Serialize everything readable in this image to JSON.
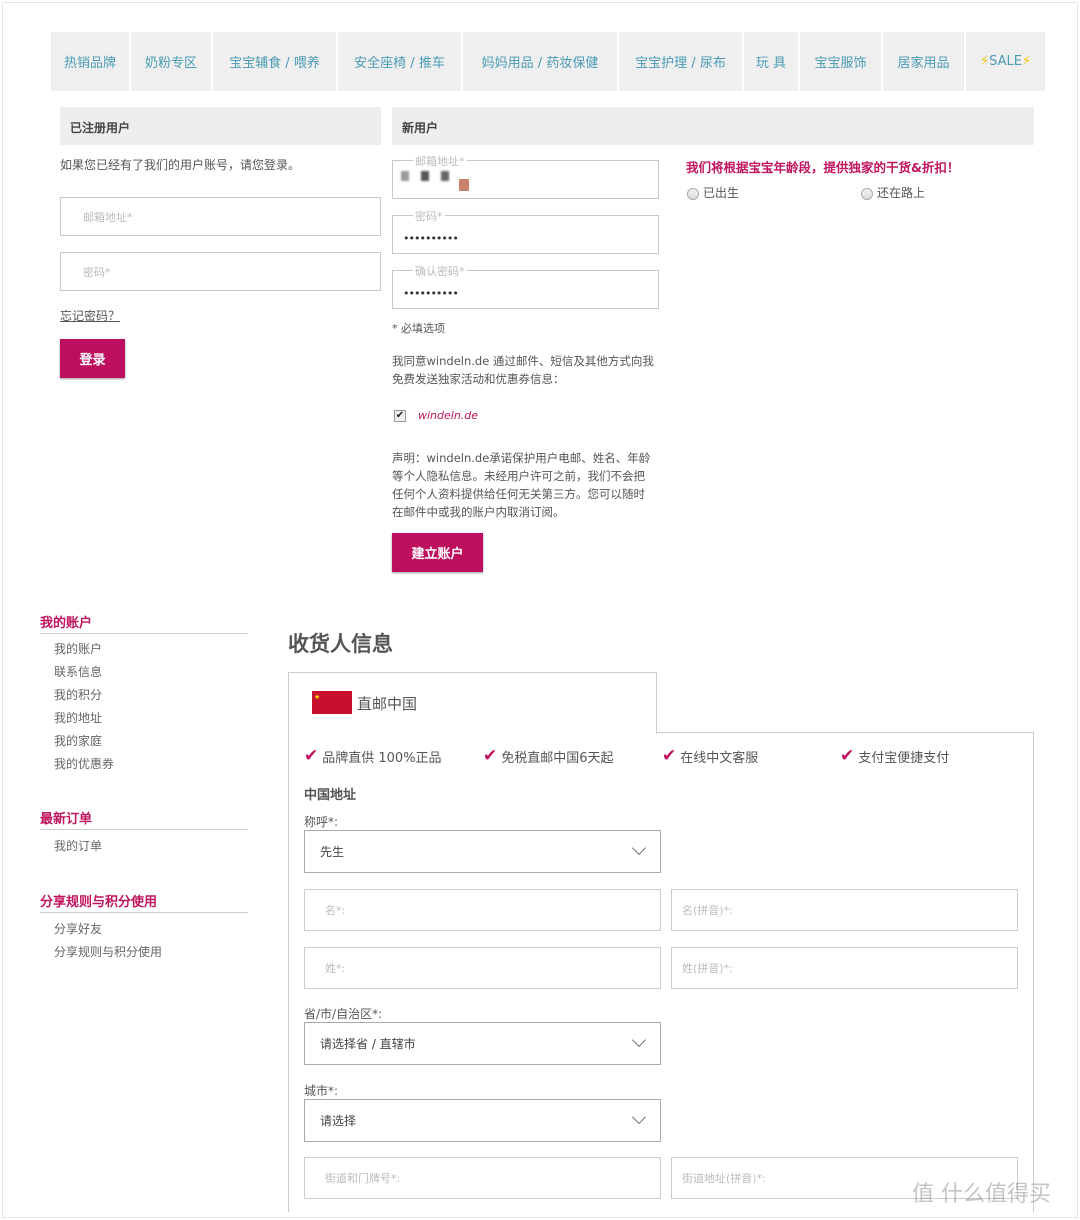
{
  "nav": [
    "热销品牌",
    "奶粉专区",
    "宝宝辅食 / 喂养",
    "安全座椅 / 推车",
    "妈妈用品 / 药妆保健",
    "宝宝护理 / 尿布",
    "玩 具",
    "宝宝服饰",
    "居家用品",
    "SALE"
  ],
  "registered": {
    "title": "已注册用户",
    "intro": "如果您已经有了我们的用户账号，请您登录。",
    "email_placeholder": "邮箱地址*",
    "password_placeholder": "密码*",
    "forgot": "忘记密码？",
    "login": "登录"
  },
  "new_user": {
    "title": "新用户",
    "email_label": "邮箱地址*",
    "password_label": "密码*",
    "password_value": "••••••••••",
    "confirm_label": "确认密码*",
    "confirm_value": "••••••••••",
    "required": "* 必填选项",
    "agree": "我同意windeln.de 通过邮件、短信及其他方式向我",
    "agree2": "免费发送独家活动和优惠券信息：",
    "brand": "windeln.de",
    "brand_checked": true,
    "disclaimer": [
      "声明：windeln.de承诺保护用户电邮、姓名、年龄",
      "等个人隐私信息。未经用户许可之前，我们不会把",
      "任何个人资料提供给任何无关第三方。您可以随时",
      "在邮件中或我的账户内取消订阅。"
    ],
    "create": "建立账户"
  },
  "promo": {
    "text": "我们将根据宝宝年龄段，提供独家的干货&折扣！",
    "options": [
      "已出生",
      "还在路上"
    ]
  },
  "sidebar": {
    "sections": [
      {
        "title": "我的账户",
        "items": [
          "我的账户",
          "联系信息",
          "我的积分",
          "我的地址",
          "我的家庭",
          "我的优惠券"
        ]
      },
      {
        "title": "最新订单",
        "items": [
          "我的订单"
        ]
      },
      {
        "title": "分享规则与积分使用",
        "items": [
          "分享好友",
          "分享规则与积分使用"
        ]
      }
    ]
  },
  "shipping": {
    "title": "收货人信息",
    "tab": "直邮中国",
    "features": [
      "品牌直供 100%正品",
      "免税直邮中国6天起",
      "在线中文客服",
      "支付宝便捷支付"
    ],
    "section": "中国地址",
    "salutation_label": "称呼*:",
    "salutation_value": "先生",
    "first_name": "名*:",
    "first_name_pinyin": "名(拼音)*:",
    "last_name": "姓*:",
    "last_name_pinyin": "姓(拼音)*:",
    "province_label": "省/市/自治区*:",
    "province_value": "请选择省 / 直辖市",
    "city_label": "城市*:",
    "city_value": "请选择",
    "street": "街道和门牌号*:",
    "street_pinyin": "街道地址(拼音)*:"
  },
  "watermark": "值 什么值得买",
  "colors": {
    "accent": "#be0f5f",
    "nav_text": "#4a9bb5"
  }
}
